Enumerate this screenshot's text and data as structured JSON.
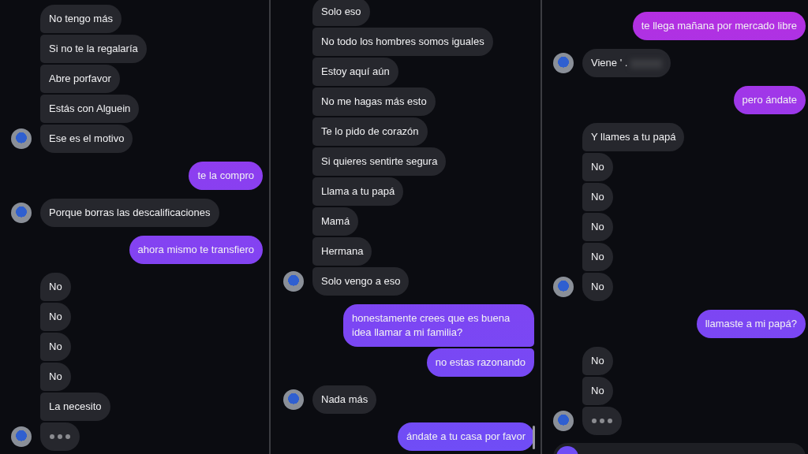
{
  "panels": [
    {
      "messages": [
        {
          "kind": "text",
          "sent": false,
          "text": "No tengo más",
          "avatar": false
        },
        {
          "kind": "text",
          "sent": false,
          "text": "Si no te la regalaría",
          "avatar": false
        },
        {
          "kind": "text",
          "sent": false,
          "text": "Abre porfavor",
          "avatar": false
        },
        {
          "kind": "text",
          "sent": false,
          "text": "Estás con Alguein",
          "avatar": false
        },
        {
          "kind": "text",
          "sent": false,
          "text": "Ese es el motivo",
          "avatar": true
        },
        {
          "kind": "text",
          "sent": true,
          "text": "te la compro",
          "avatar": false
        },
        {
          "kind": "text",
          "sent": false,
          "text": "Porque borras las descalificaciones",
          "avatar": true
        },
        {
          "kind": "text",
          "sent": true,
          "text": "ahora mismo te transfiero",
          "avatar": false
        },
        {
          "kind": "text",
          "sent": false,
          "text": "No",
          "avatar": false
        },
        {
          "kind": "text",
          "sent": false,
          "text": "No",
          "avatar": false
        },
        {
          "kind": "text",
          "sent": false,
          "text": "No",
          "avatar": false
        },
        {
          "kind": "text",
          "sent": false,
          "text": "No",
          "avatar": false
        },
        {
          "kind": "text",
          "sent": false,
          "text": "La necesito",
          "avatar": false
        },
        {
          "kind": "typing",
          "sent": false,
          "avatar": true
        }
      ]
    },
    {
      "scrollbar": true,
      "messages": [
        {
          "kind": "text",
          "sent": false,
          "text": "Solo eso",
          "avatar": false
        },
        {
          "kind": "text",
          "sent": false,
          "text": "No todo los hombres somos iguales",
          "avatar": false
        },
        {
          "kind": "text",
          "sent": false,
          "text": "Estoy aquí aún",
          "avatar": false
        },
        {
          "kind": "text",
          "sent": false,
          "text": "No me hagas más esto",
          "avatar": false
        },
        {
          "kind": "text",
          "sent": false,
          "text": "Te lo pido de corazón",
          "avatar": false
        },
        {
          "kind": "text",
          "sent": false,
          "text": "Si quieres sentirte segura",
          "avatar": false
        },
        {
          "kind": "text",
          "sent": false,
          "text": "Llama a tu papá",
          "avatar": false
        },
        {
          "kind": "text",
          "sent": false,
          "text": "Mamá",
          "avatar": false
        },
        {
          "kind": "text",
          "sent": false,
          "text": "Hermana",
          "avatar": false
        },
        {
          "kind": "text",
          "sent": false,
          "text": "Solo vengo a eso",
          "avatar": true
        },
        {
          "kind": "text",
          "sent": true,
          "text": "honestamente crees que es buena idea llamar a mi familia?",
          "avatar": false
        },
        {
          "kind": "text",
          "sent": true,
          "text": "no estas razonando",
          "avatar": false
        },
        {
          "kind": "text",
          "sent": false,
          "text": "Nada más",
          "avatar": true
        },
        {
          "kind": "text",
          "sent": true,
          "text": "ándate a tu casa por favor",
          "avatar": false
        }
      ]
    },
    {
      "composer": true,
      "messages": [
        {
          "kind": "text",
          "sent": true,
          "text": "te llega mañana por mercado libre",
          "avatar": false
        },
        {
          "kind": "text",
          "sent": false,
          "text": "Viene ' .",
          "avatar": true,
          "redacted": true
        },
        {
          "kind": "text",
          "sent": true,
          "text": "pero ándate",
          "avatar": false
        },
        {
          "kind": "text",
          "sent": false,
          "text": "Y llames a tu papá",
          "avatar": false
        },
        {
          "kind": "text",
          "sent": false,
          "text": "No",
          "avatar": false
        },
        {
          "kind": "text",
          "sent": false,
          "text": "No",
          "avatar": false
        },
        {
          "kind": "text",
          "sent": false,
          "text": "No",
          "avatar": false
        },
        {
          "kind": "text",
          "sent": false,
          "text": "No",
          "avatar": false
        },
        {
          "kind": "text",
          "sent": false,
          "text": "No",
          "avatar": true
        },
        {
          "kind": "text",
          "sent": true,
          "text": "llamaste a mi papá?",
          "avatar": false
        },
        {
          "kind": "text",
          "sent": false,
          "text": "No",
          "avatar": false
        },
        {
          "kind": "text",
          "sent": false,
          "text": "No",
          "avatar": false
        },
        {
          "kind": "typing",
          "sent": false,
          "avatar": true
        }
      ]
    }
  ]
}
